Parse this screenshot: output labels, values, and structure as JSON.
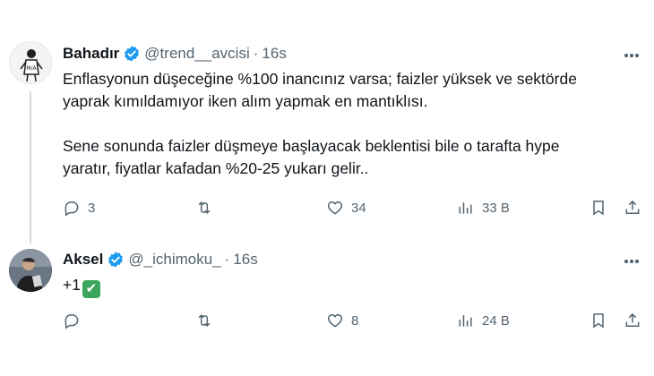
{
  "tweets": [
    {
      "author": "Bahadır",
      "handle": "@trend__avcisi",
      "separator": "·",
      "time": "16s",
      "verified": true,
      "avatar_icon": "figure-sketch-avatar",
      "body": [
        "Enflasyonun düşeceğine %100 inancınız varsa; faizler yüksek ve sektörde",
        "yaprak kımıldamıyor iken alım yapmak en mantıklısı.",
        "",
        "Sene sonunda faizler düşmeye başlayacak beklentisi bile o tarafta hype",
        "yaratır, fiyatlar kafadan %20-25 yukarı gelir.."
      ],
      "replies": "3",
      "retweets": "",
      "likes": "34",
      "views": "33 B"
    },
    {
      "author": "Aksel",
      "handle": "@_ichimoku_",
      "separator": "·",
      "time": "16s",
      "verified": true,
      "avatar_icon": "person-photo-avatar",
      "body_text": "+1",
      "body_emoji": "✔",
      "replies": "",
      "retweets": "",
      "likes": "8",
      "views": "24 B"
    }
  ],
  "colors": {
    "verified_blue": "#1d9bf0",
    "secondary_text": "#536471",
    "thread_line": "#cfd9de"
  }
}
